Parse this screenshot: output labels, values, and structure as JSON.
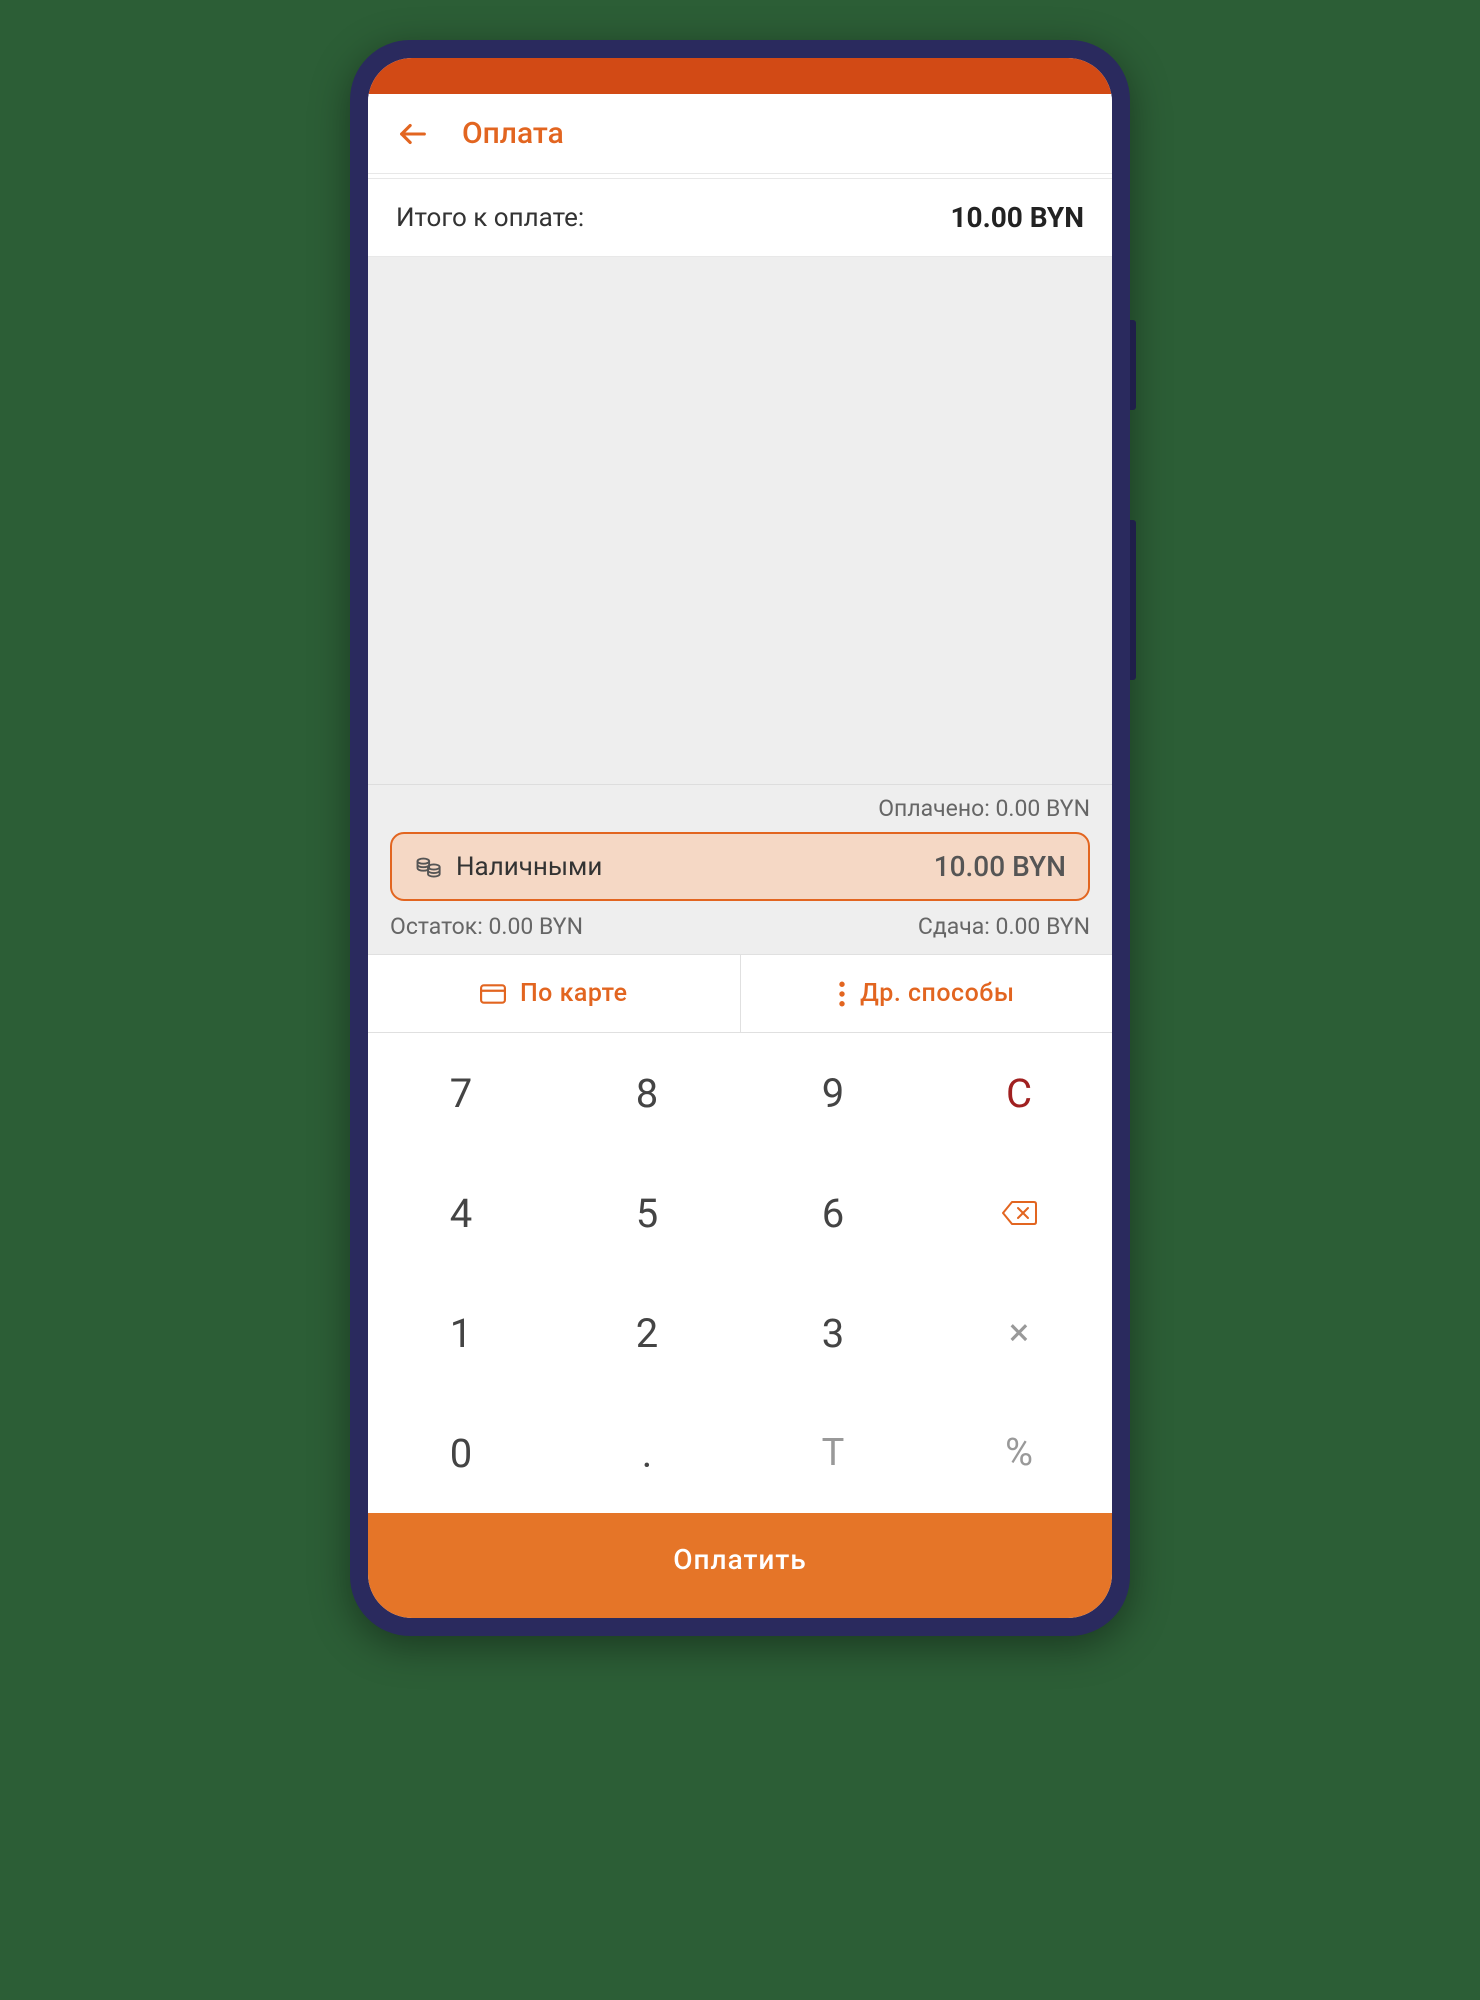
{
  "header": {
    "title": "Оплата"
  },
  "total": {
    "label": "Итого к оплате:",
    "value": "10.00 BYN"
  },
  "paid": {
    "label": "Оплачено: 0.00 BYN"
  },
  "cash": {
    "label": "Наличными",
    "amount": "10.00 BYN"
  },
  "balance": {
    "remaining": "Остаток: 0.00 BYN",
    "change": "Сдача: 0.00 BYN"
  },
  "methods": {
    "card": "По карте",
    "other": "Др. способы"
  },
  "keypad": {
    "k7": "7",
    "k8": "8",
    "k9": "9",
    "kc": "C",
    "k4": "4",
    "k5": "5",
    "k6": "6",
    "k1": "1",
    "k2": "2",
    "k3": "3",
    "kx": "×",
    "k0": "0",
    "kdot": ".",
    "kt": "T",
    "kpct": "%"
  },
  "pay": {
    "label": "Оплатить"
  }
}
